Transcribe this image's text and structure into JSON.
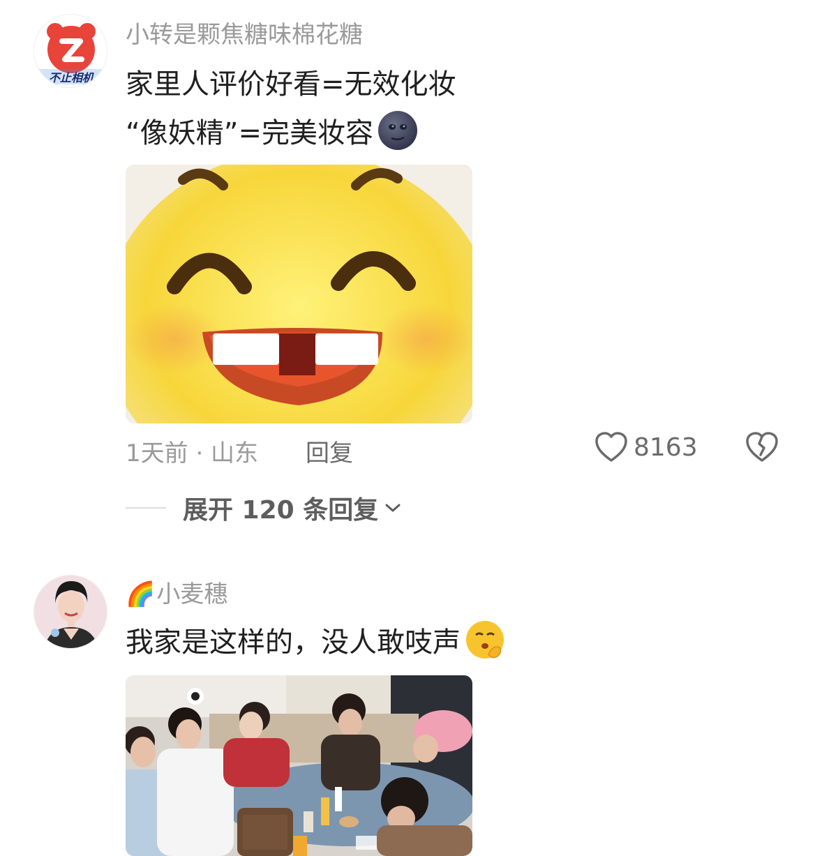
{
  "comments": [
    {
      "username": "小转是颗焦糖味棉花糖",
      "avatar_badge": "不止相机",
      "lines": [
        "家里人评价好看=无效化妆",
        "“像妖精”=完美妆容"
      ],
      "inline_emoji": "new-moon-face-emoji",
      "time_location": "1天前 · 山东",
      "reply_label": "回复",
      "like_count": "8163",
      "expand_label": "展开 120 条回复"
    },
    {
      "username_prefix_emoji": "🌈",
      "username": "小麦穗",
      "lines": [
        "我家是这样的，没人敢吱声"
      ],
      "inline_emoji": "shushing-face-emoji"
    }
  ],
  "colors": {
    "username": "#9a9a9a",
    "body_text": "#1f1f1f",
    "meta_text": "#9a9a9a",
    "action_text": "#6a6a6a",
    "avatar_red": "#e8443a"
  }
}
